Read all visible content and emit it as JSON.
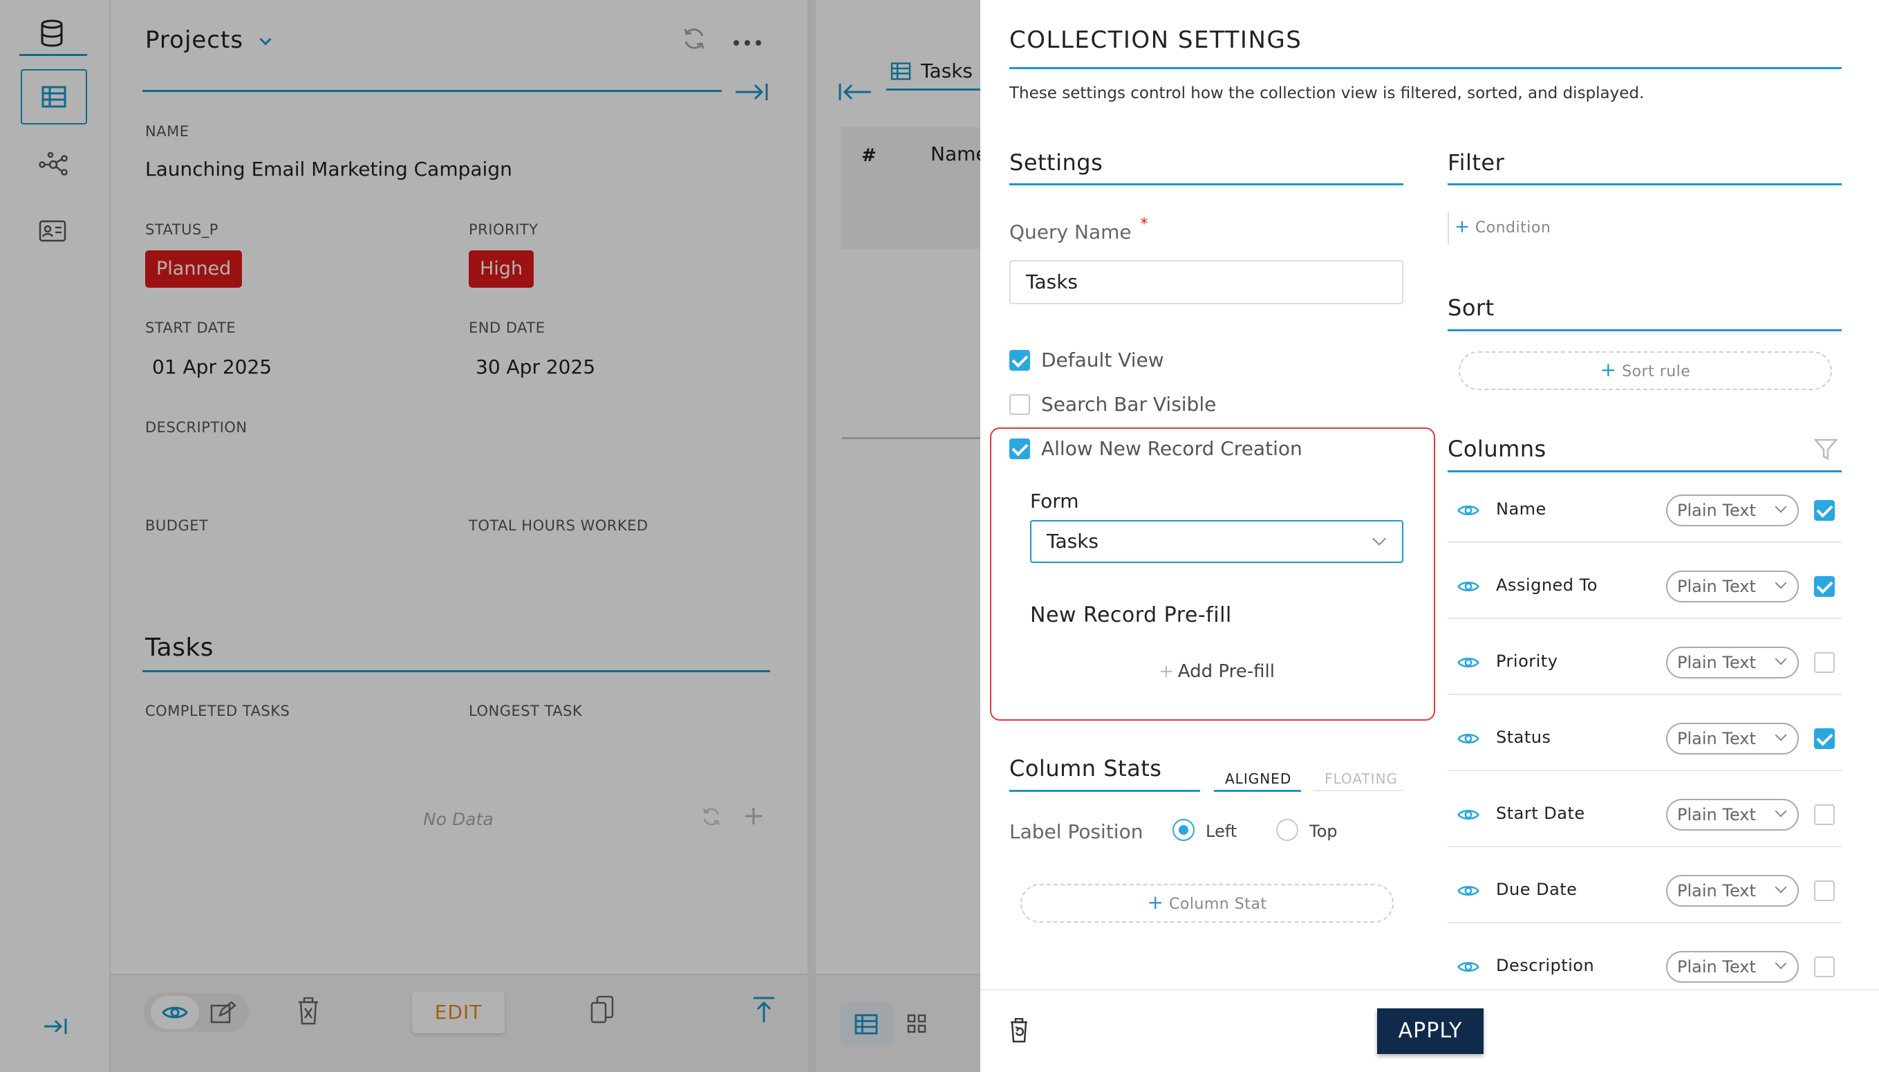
{
  "background": {
    "project": {
      "title": "Projects",
      "name_label": "NAME",
      "name_value": "Launching Email Marketing Campaign",
      "status_label": "STATUS_P",
      "status_value": "Planned",
      "priority_label": "PRIORITY",
      "priority_value": "High",
      "start_label": "START DATE",
      "start_value": "01 Apr 2025",
      "end_label": "END DATE",
      "end_value": "30 Apr 2025",
      "description_label": "DESCRIPTION",
      "budget_label": "BUDGET",
      "hours_label": "TOTAL HOURS WORKED",
      "tasks_heading": "Tasks",
      "completed_label": "COMPLETED TASKS",
      "longest_label": "LONGEST TASK",
      "no_data": "No Data",
      "edit_label": "EDIT"
    },
    "tasks_panel": {
      "tab_label": "Tasks",
      "col_hash": "#",
      "col_name": "Name"
    }
  },
  "modal": {
    "title": "COLLECTION SETTINGS",
    "description": "These settings control how the collection view is filtered, sorted, and displayed.",
    "settings": {
      "heading": "Settings",
      "query_name_label": "Query Name",
      "required_mark": "*",
      "query_name_value": "Tasks",
      "default_view": {
        "label": "Default View",
        "checked": true
      },
      "search_bar": {
        "label": "Search Bar Visible",
        "checked": false
      },
      "allow_new": {
        "label": "Allow New Record Creation",
        "checked": true
      },
      "form_label": "Form",
      "form_value": "Tasks",
      "prefill_heading": "New Record Pre-fill",
      "add_prefill": "Add Pre-fill"
    },
    "column_stats": {
      "heading": "Column Stats",
      "tab_aligned": "ALIGNED",
      "tab_floating": "FLOATING",
      "label_position": "Label Position",
      "option_left": "Left",
      "option_top": "Top",
      "selected": "Left",
      "add_stat": "Column Stat"
    },
    "filter": {
      "heading": "Filter",
      "add_condition": "Condition"
    },
    "sort": {
      "heading": "Sort",
      "add_rule": "Sort rule"
    },
    "columns": {
      "heading": "Columns",
      "items": [
        {
          "name": "Name",
          "type": "Plain Text",
          "checked": true
        },
        {
          "name": "Assigned To",
          "type": "Plain Text",
          "checked": true
        },
        {
          "name": "Priority",
          "type": "Plain Text",
          "checked": false
        },
        {
          "name": "Status",
          "type": "Plain Text",
          "checked": true
        },
        {
          "name": "Start Date",
          "type": "Plain Text",
          "checked": false
        },
        {
          "name": "Due Date",
          "type": "Plain Text",
          "checked": false
        },
        {
          "name": "Description",
          "type": "Plain Text",
          "checked": false
        }
      ]
    },
    "apply_label": "APPLY"
  },
  "colors": {
    "accent": "#1b97c9",
    "badge": "#e01b1b",
    "apply": "#0f2a4a",
    "highlight": "#e53935"
  }
}
